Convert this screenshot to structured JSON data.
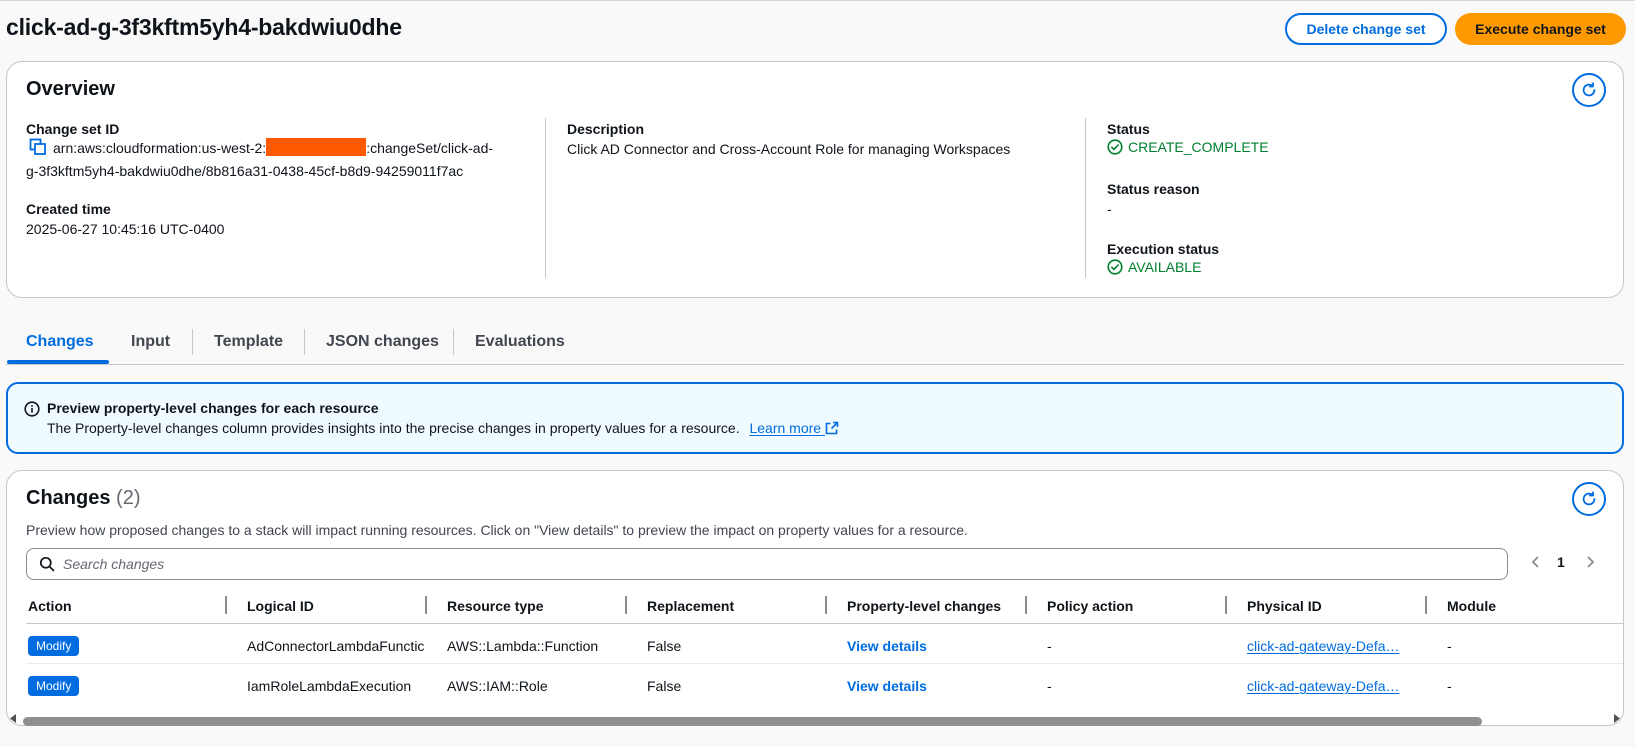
{
  "header": {
    "title": "click-ad-g-3f3kftm5yh4-bakdwiu0dhe",
    "delete_label": "Delete change set",
    "execute_label": "Execute change set"
  },
  "overview": {
    "title": "Overview",
    "change_set_id_label": "Change set ID",
    "change_set_id_prefix": "arn:aws:cloudformation:us-west-2:",
    "change_set_id_suffix": ":changeSet/click-ad-",
    "change_set_id_line2": "g-3f3kftm5yh4-bakdwiu0dhe/8b816a31-0438-45cf-b8d9-94259011f7ac",
    "created_time_label": "Created time",
    "created_time": "2025-06-27 10:45:16 UTC-0400",
    "description_label": "Description",
    "description": "Click AD Connector and Cross-Account Role for managing Workspaces",
    "status_label": "Status",
    "status": "CREATE_COMPLETE",
    "status_reason_label": "Status reason",
    "status_reason": "-",
    "execution_status_label": "Execution status",
    "execution_status": "AVAILABLE",
    "colors": {
      "success": "#00802f",
      "redaction": "#ff5a00"
    }
  },
  "tabs": [
    {
      "label": "Changes",
      "active": true
    },
    {
      "label": "Input",
      "active": false
    },
    {
      "label": "Template",
      "active": false
    },
    {
      "label": "JSON changes",
      "active": false
    },
    {
      "label": "Evaluations",
      "active": false
    }
  ],
  "info": {
    "title": "Preview property-level changes for each resource",
    "text": "The Property-level changes column provides insights into the precise changes in property values for a resource.",
    "link": "Learn more"
  },
  "changes": {
    "title": "Changes",
    "count": "(2)",
    "description": "Preview how proposed changes to a stack will impact running resources. Click on \"View details\" to preview the impact on property values for a resource.",
    "search_placeholder": "Search changes",
    "page": "1",
    "columns": [
      "Action",
      "Logical ID",
      "Resource type",
      "Replacement",
      "Property-level changes",
      "Policy action",
      "Physical ID",
      "Module"
    ],
    "rows": [
      {
        "action": "Modify",
        "logical_id": "AdConnectorLambdaFunctic",
        "resource_type": "AWS::Lambda::Function",
        "replacement": "False",
        "property_changes": "View details",
        "policy_action": "-",
        "physical_id": "click-ad-gateway-Defa…",
        "module": "-"
      },
      {
        "action": "Modify",
        "logical_id": "IamRoleLambdaExecution",
        "resource_type": "AWS::IAM::Role",
        "replacement": "False",
        "property_changes": "View details",
        "policy_action": "-",
        "physical_id": "click-ad-gateway-Defa…",
        "module": "-"
      }
    ]
  },
  "scrollbar": {
    "position_fraction": 0.0,
    "visible_fraction": 0.92
  }
}
